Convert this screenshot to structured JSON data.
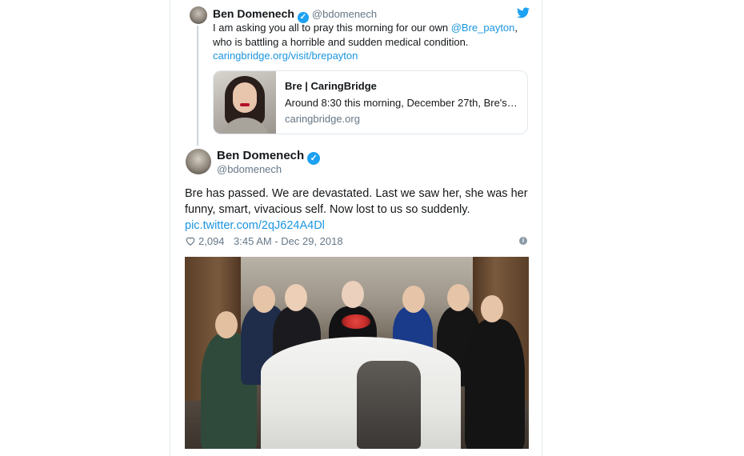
{
  "colors": {
    "accent": "#1da1f2",
    "link": "#1b95e0",
    "secondary_text": "#657786",
    "border": "#e6ecf0"
  },
  "quoted_tweet": {
    "author_name": "Ben Domenech",
    "author_handle": "@bdomenech",
    "text_part1": "I am asking you all to pray this morning for our own ",
    "mention": "@Bre_payton",
    "text_part2": ",",
    "text_line2": "who is battling a horrible and sudden medical condition.",
    "url": "caringbridge.org/visit/brepayton",
    "link_card": {
      "title": "Bre | CaringBridge",
      "description": "Around 8:30 this morning, December 27th, Bre's…",
      "domain": "caringbridge.org"
    },
    "icons": {
      "avatar": "avatar-photo",
      "verified": "verified-badge-icon",
      "platform": "twitter-bird-icon"
    }
  },
  "main_tweet": {
    "author_name": "Ben Domenech",
    "author_handle": "@bdomenech",
    "text_line1": "Bre has passed. We are devastated. Last we saw her, she was her",
    "text_line2": "funny, smart, vivacious self. Now lost to us so suddenly.",
    "link": "pic.twitter.com/2qJ624A4Dl",
    "likes": "2,094",
    "timestamp": "3:45 AM - Dec 29, 2018",
    "icons": {
      "likes": "heart-icon",
      "info": "info-icon"
    }
  }
}
